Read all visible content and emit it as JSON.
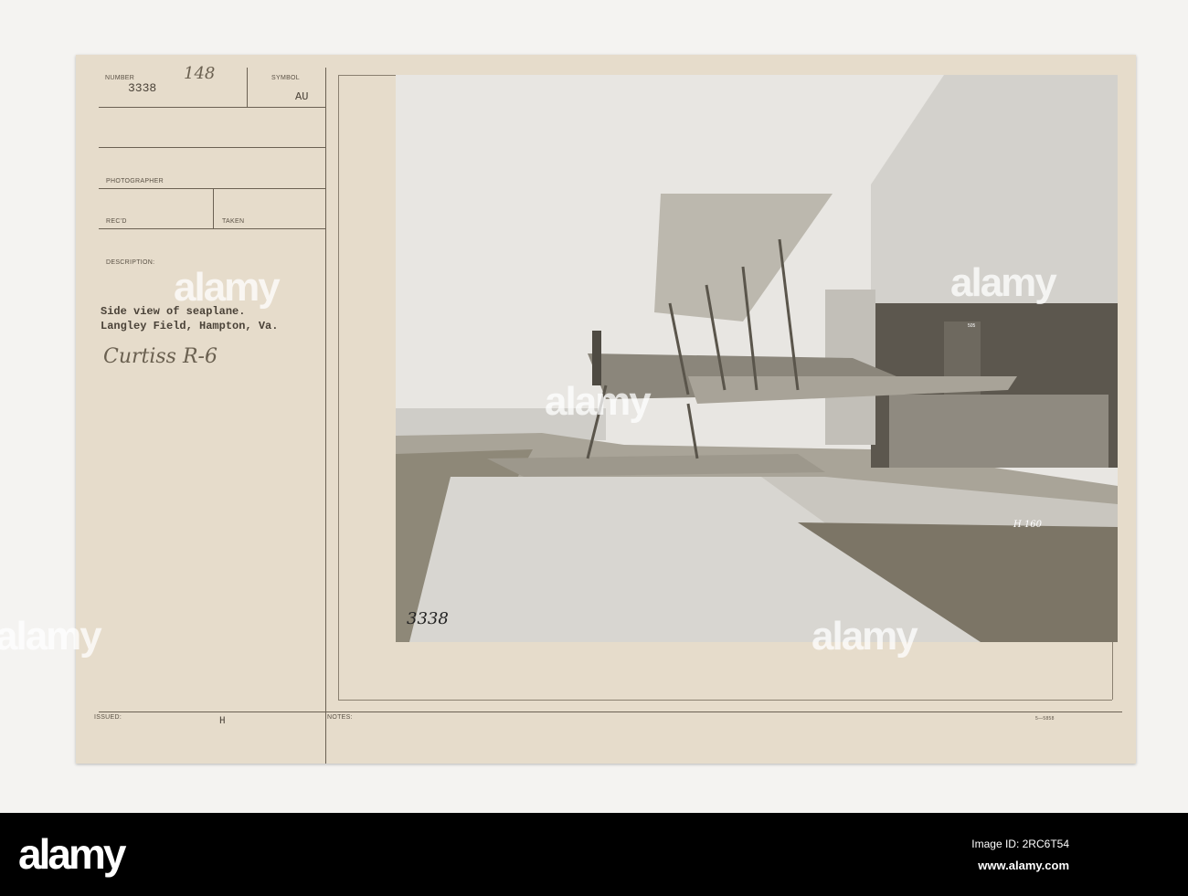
{
  "card": {
    "number_label": "NUMBER",
    "number": "3338",
    "handwritten_number": "148",
    "symbol_label": "SYMBOL",
    "symbol": "AU",
    "photographer_label": "PHOTOGRAPHER",
    "recd_label": "REC'D",
    "taken_label": "TAKEN",
    "description_label": "DESCRIPTION:",
    "description_line1": "Side view of seaplane.",
    "description_line2": "Langley Field, Hampton, Va.",
    "handwritten_note": "Curtiss R-6",
    "issued_label": "ISSUED:",
    "issued_value": "H",
    "notes_label": "NOTES:",
    "form_code": "5—5858"
  },
  "photo": {
    "negative_number": "3338",
    "plate_mark": "H 160",
    "tail_number": "505"
  },
  "watermark": {
    "text": "alamy",
    "image_id": "Image ID: 2RC6T54",
    "url": "www.alamy.com"
  }
}
